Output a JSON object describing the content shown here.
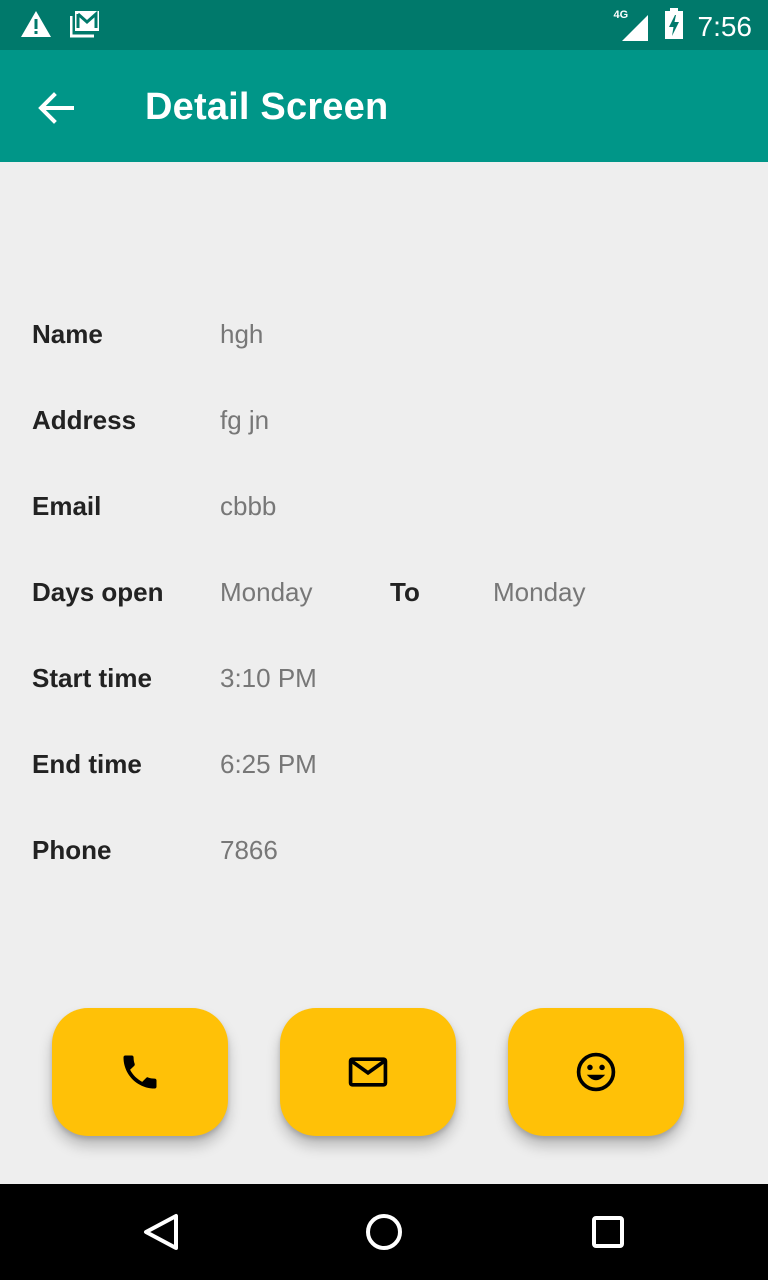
{
  "status_bar": {
    "time": "7:56",
    "network_type": "4G",
    "icons": [
      "warning-icon",
      "gmail-icon",
      "signal-icon",
      "battery-charging-icon"
    ]
  },
  "app_bar": {
    "title": "Detail Screen",
    "back_icon": "arrow-back-icon"
  },
  "details": {
    "name": {
      "label": "Name",
      "value": "hgh"
    },
    "address": {
      "label": "Address",
      "value": "fg jn"
    },
    "email": {
      "label": "Email",
      "value": "cbbb"
    },
    "days_open": {
      "label": "Days open",
      "from": "Monday",
      "to_label": "To",
      "to": "Monday"
    },
    "start_time": {
      "label": "Start time",
      "value": "3:10 PM"
    },
    "end_time": {
      "label": "End time",
      "value": "6:25 PM"
    },
    "phone": {
      "label": "Phone",
      "value": "7866"
    }
  },
  "actions": [
    {
      "icon": "phone-icon"
    },
    {
      "icon": "mail-icon"
    },
    {
      "icon": "smiley-icon"
    }
  ],
  "nav_bar": {
    "icons": [
      "back-triangle-icon",
      "home-circle-icon",
      "recents-square-icon"
    ]
  },
  "colors": {
    "status_bar": "#00796b",
    "app_bar": "#009688",
    "background": "#eeeeee",
    "fab": "#ffc107",
    "label_text": "#222222",
    "value_text": "#777777"
  }
}
